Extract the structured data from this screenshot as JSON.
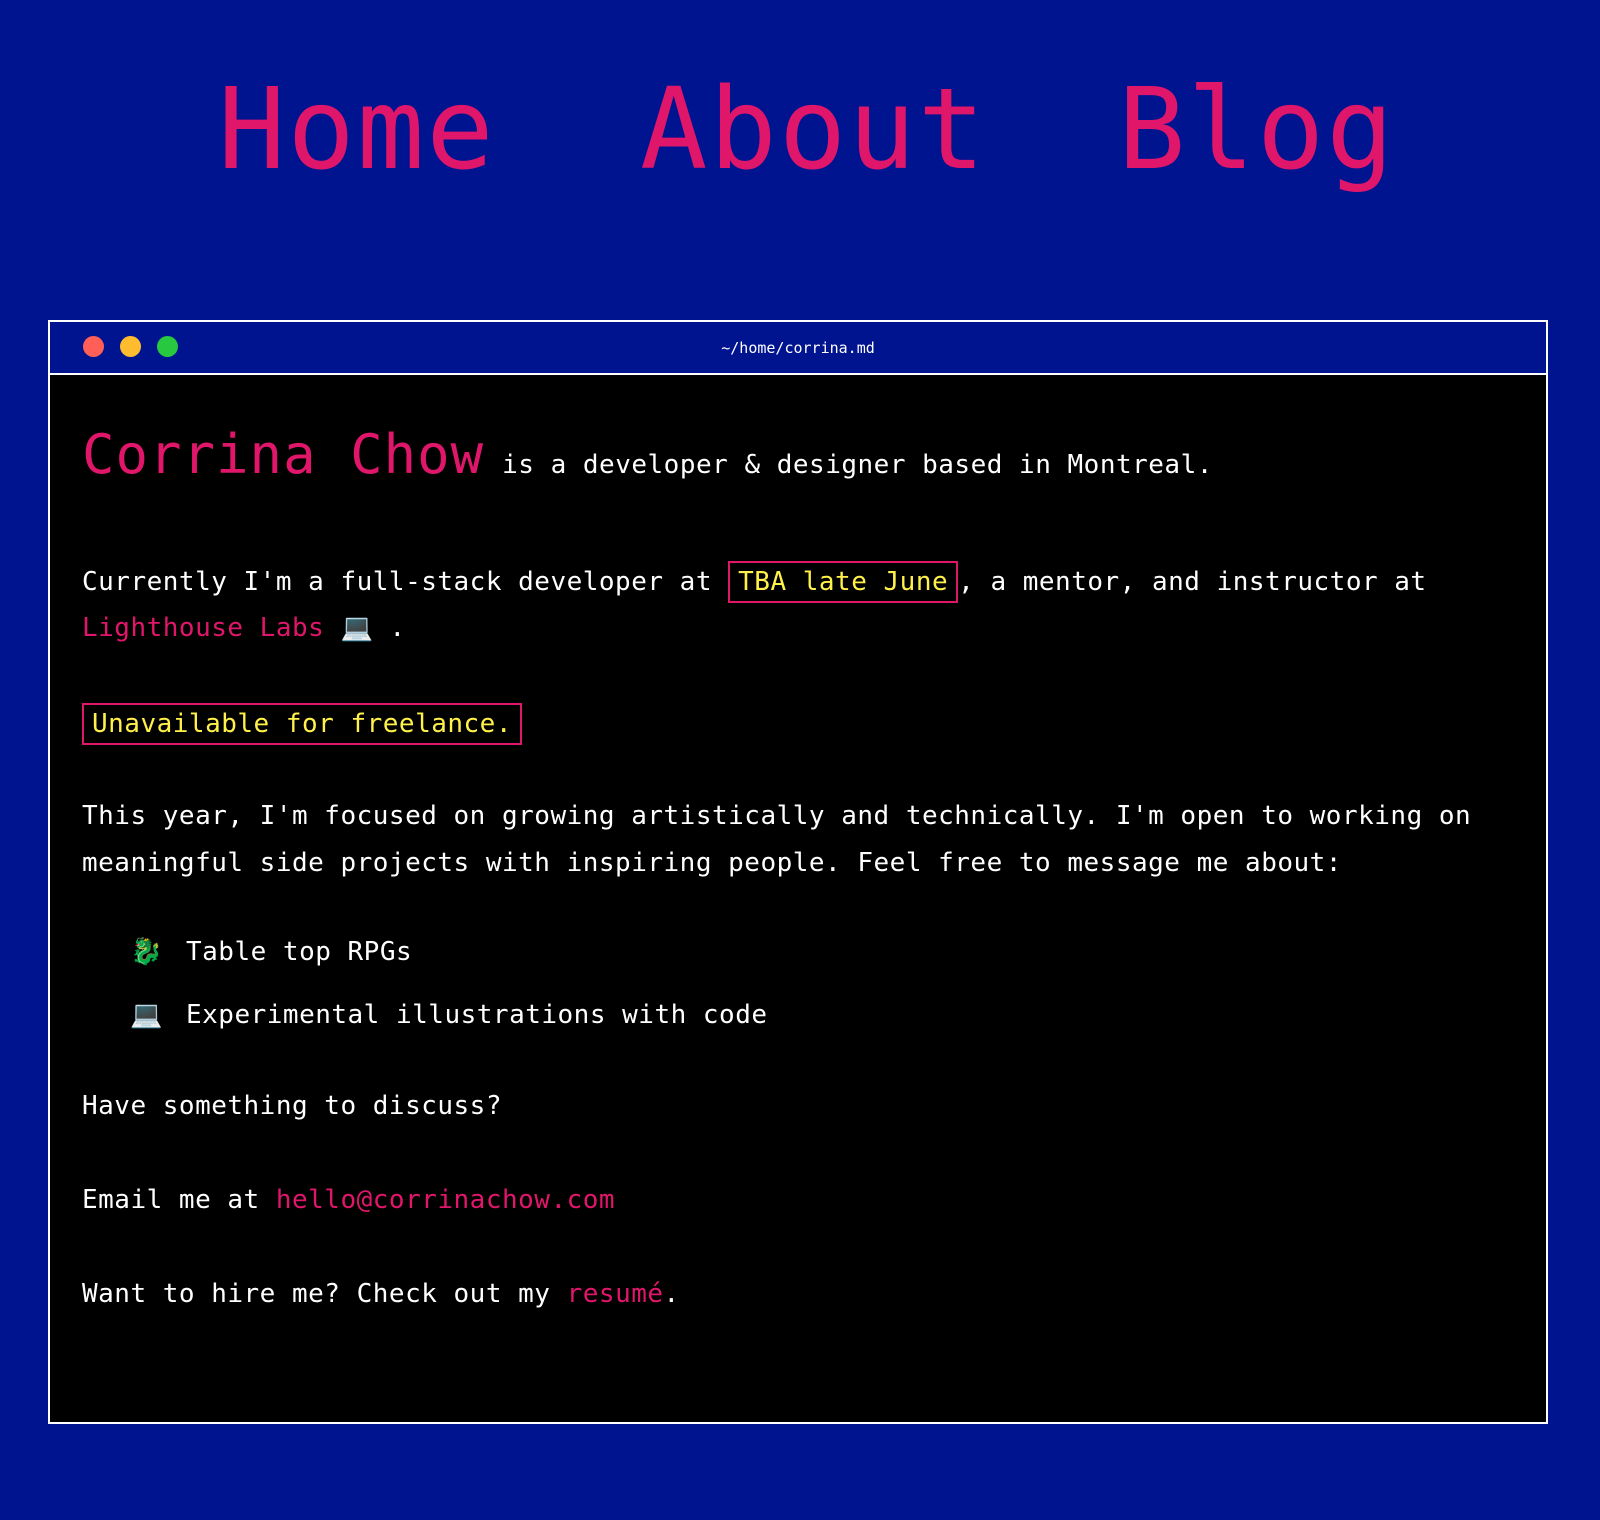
{
  "nav": {
    "home": "Home",
    "about": "About",
    "blog": "Blog"
  },
  "window": {
    "title": "~/home/corrina.md"
  },
  "hero": {
    "name": "Corrina Chow",
    "tagline": "is a developer & designer based in Montreal."
  },
  "intro": {
    "prefix": "Currently I'm a full-stack developer at",
    "employer": "TBA late June",
    "middle": ", a mentor, and instructor at",
    "school_link": "Lighthouse Labs",
    "school_emoji": "💻",
    "suffix": "."
  },
  "availability": "Unavailable for freelance.",
  "focus": {
    "line1": "This year, I'm focused on growing artistically and technically. I'm open to working on",
    "line2": "meaningful side projects with inspiring people. Feel free to message me about:"
  },
  "topics": [
    {
      "emoji": "🐉",
      "label": "Table top RPGs"
    },
    {
      "emoji": "💻",
      "label": "Experimental illustrations with code"
    }
  ],
  "discuss": "Have something to discuss?",
  "email": {
    "prefix": "Email me at",
    "address": "hello@corrinachow.com"
  },
  "hire": {
    "prefix": "Want to hire me? Check out my",
    "link": "resumé",
    "suffix": "."
  }
}
